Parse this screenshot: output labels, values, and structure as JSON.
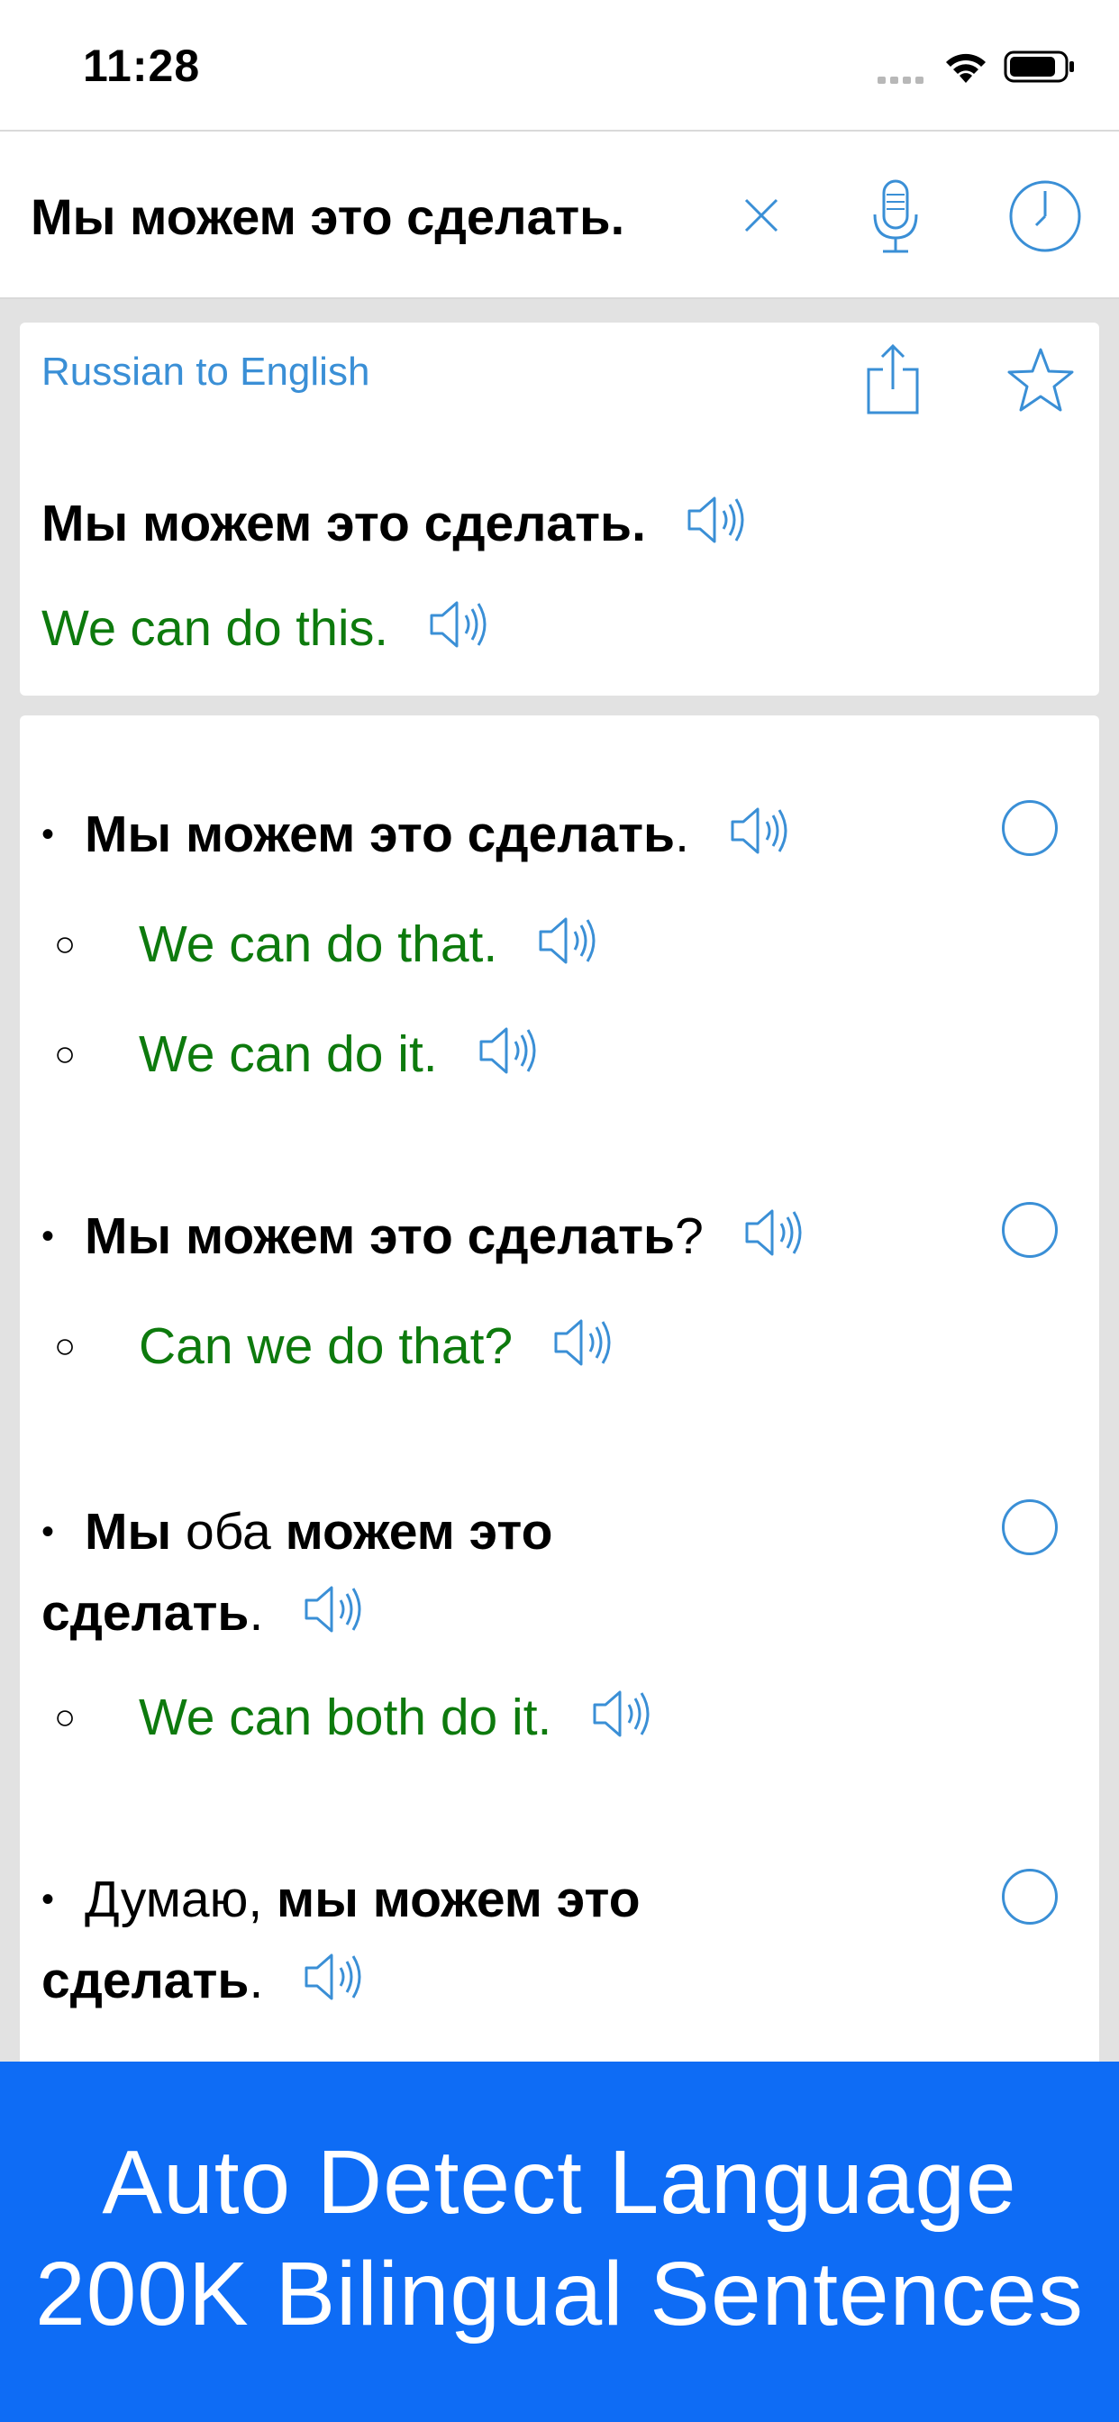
{
  "status_bar": {
    "time": "11:28"
  },
  "search": {
    "query": "Мы можем это сделать."
  },
  "result": {
    "direction": "Russian to English",
    "source": "Мы можем это сделать.",
    "translation": "We can do this."
  },
  "examples": [
    {
      "source_parts": [
        {
          "text": "Мы можем это сделать",
          "bold": true
        },
        {
          "text": ".",
          "bold": false
        }
      ],
      "translations": [
        "We can do that.",
        "We can do it."
      ]
    },
    {
      "source_parts": [
        {
          "text": "Мы можем это сделать",
          "bold": true
        },
        {
          "text": "?",
          "bold": false
        }
      ],
      "translations": [
        "Can we do that?"
      ]
    },
    {
      "source_parts": [
        {
          "text": "Мы",
          "bold": true
        },
        {
          "text": " оба ",
          "bold": false
        },
        {
          "text": "можем это сделать",
          "bold": true
        },
        {
          "text": ".",
          "bold": false
        }
      ],
      "translations": [
        "We can both do it."
      ]
    },
    {
      "source_parts": [
        {
          "text": "Думаю, ",
          "bold": false
        },
        {
          "text": "мы можем это сделать",
          "bold": true
        },
        {
          "text": ".",
          "bold": false
        }
      ],
      "translations": []
    }
  ],
  "banner": {
    "line1": "Auto Detect Language",
    "line2": "200K Bilingual Sentences"
  },
  "icons": {
    "clear": "close-icon",
    "mic": "microphone-icon",
    "history": "clock-icon",
    "share": "share-icon",
    "favorite": "star-icon",
    "speak": "speaker-icon"
  },
  "colors": {
    "accent": "#3a8fd6",
    "translation": "#0d7a0d",
    "banner": "#0e6cf5",
    "background": "#e2e2e2"
  }
}
